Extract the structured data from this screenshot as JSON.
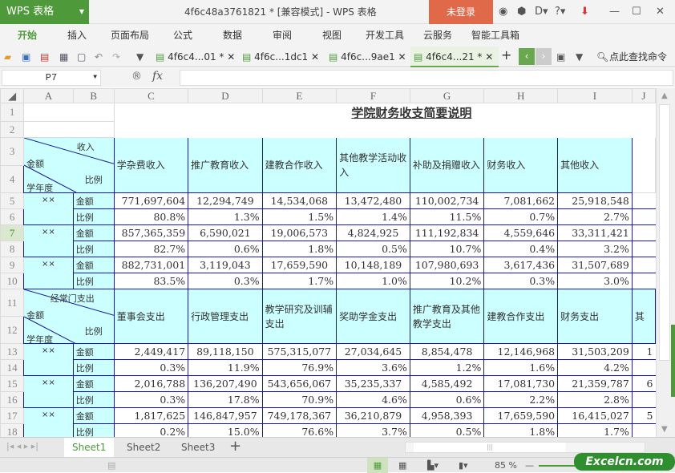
{
  "app": {
    "logo": "WPS 表格",
    "title": "4f6c48a3761821 * [兼容模式] - WPS 表格",
    "login": "未登录"
  },
  "menu": [
    "开始",
    "插入",
    "页面布局",
    "公式",
    "数据",
    "审阅",
    "视图",
    "开发工具",
    "云服务",
    "智能工具箱"
  ],
  "doc_tabs": [
    {
      "label": "4f6c4...01 *"
    },
    {
      "label": "4f6c...1dc1"
    },
    {
      "label": "4f6c...9ae1"
    },
    {
      "label": "4f6c4...21 *",
      "active": true
    }
  ],
  "search_label": "点此查找命令",
  "formula": {
    "cell_ref": "P7",
    "fx": "fx",
    "value": ""
  },
  "columns": [
    "A",
    "B",
    "C",
    "D",
    "E",
    "F",
    "G",
    "H",
    "I"
  ],
  "rows": [
    "1",
    "2",
    "3",
    "4",
    "5",
    "6",
    "7",
    "8",
    "9",
    "10",
    "11",
    "12",
    "13",
    "14",
    "15",
    "16",
    "17",
    "18"
  ],
  "title": "学院财务收支简要说明",
  "income": {
    "h_top": "收入",
    "h_mid": "金额",
    "h_ratio": "比例",
    "h_year": "学年度",
    "headers": [
      "学杂费收入",
      "推广教育收入",
      "建教合作收入",
      "其他教学活动收入",
      "补助及捐赠收入",
      "财务收入",
      "其他收入"
    ],
    "groups": [
      {
        "year": "××",
        "amount_label": "金额",
        "ratio_label": "比例",
        "amounts": [
          "771,697,604",
          "12,294,749",
          "14,534,068",
          "13,472,480",
          "110,002,734",
          "7,081,662",
          "25,918,548"
        ],
        "ratios": [
          "80.8%",
          "1.3%",
          "1.5%",
          "1.4%",
          "11.5%",
          "0.7%",
          "2.7%"
        ]
      },
      {
        "year": "××",
        "amount_label": "金额",
        "ratio_label": "比例",
        "amounts": [
          "857,365,359",
          "6,590,021",
          "19,006,573",
          "4,824,925",
          "111,192,834",
          "4,559,646",
          "33,311,421"
        ],
        "ratios": [
          "82.7%",
          "0.6%",
          "1.8%",
          "0.5%",
          "10.7%",
          "0.4%",
          "3.2%"
        ]
      },
      {
        "year": "××",
        "amount_label": "金额",
        "ratio_label": "比例",
        "amounts": [
          "882,731,001",
          "3,119,043",
          "17,659,590",
          "10,148,189",
          "107,980,693",
          "3,617,436",
          "31,507,689"
        ],
        "ratios": [
          "83.5%",
          "0.3%",
          "1.7%",
          "1.0%",
          "10.2%",
          "0.3%",
          "3.0%"
        ]
      }
    ]
  },
  "expense": {
    "h_top": "经常门支出",
    "h_mid": "金额",
    "h_ratio": "比例",
    "h_year": "学年度",
    "headers": [
      "董事会支出",
      "行政管理支出",
      "教学研究及训辅支出",
      "奖助学金支出",
      "推广教育及其他教学支出",
      "建教合作支出",
      "财务支出",
      "其"
    ],
    "groups": [
      {
        "year": "××",
        "amount_label": "金额",
        "ratio_label": "比例",
        "amounts": [
          "2,449,417",
          "89,118,150",
          "575,315,077",
          "27,034,645",
          "8,854,478",
          "12,146,968",
          "31,503,209",
          "1"
        ],
        "ratios": [
          "0.3%",
          "11.9%",
          "76.9%",
          "3.6%",
          "1.2%",
          "1.6%",
          "4.2%",
          ""
        ]
      },
      {
        "year": "××",
        "amount_label": "金额",
        "ratio_label": "比例",
        "amounts": [
          "2,016,788",
          "136,207,490",
          "543,656,067",
          "35,235,337",
          "4,585,492",
          "17,081,730",
          "21,359,787",
          "6"
        ],
        "ratios": [
          "0.3%",
          "17.8%",
          "70.9%",
          "4.6%",
          "0.6%",
          "2.2%",
          "2.8%",
          ""
        ]
      },
      {
        "year": "××",
        "amount_label": "金额",
        "ratio_label": "比例",
        "amounts": [
          "1,817,625",
          "146,847,957",
          "749,178,367",
          "36,210,879",
          "4,958,393",
          "17,659,590",
          "16,415,027",
          "5"
        ],
        "ratios": [
          "0.2%",
          "15.0%",
          "76.6%",
          "3.7%",
          "0.5%",
          "1.8%",
          "1.7%",
          ""
        ]
      }
    ]
  },
  "sheets": [
    {
      "label": "Sheet1",
      "active": true
    },
    {
      "label": "Sheet2"
    },
    {
      "label": "Sheet3"
    }
  ],
  "zoom": "85 %",
  "watermark": "Excelcn.com"
}
